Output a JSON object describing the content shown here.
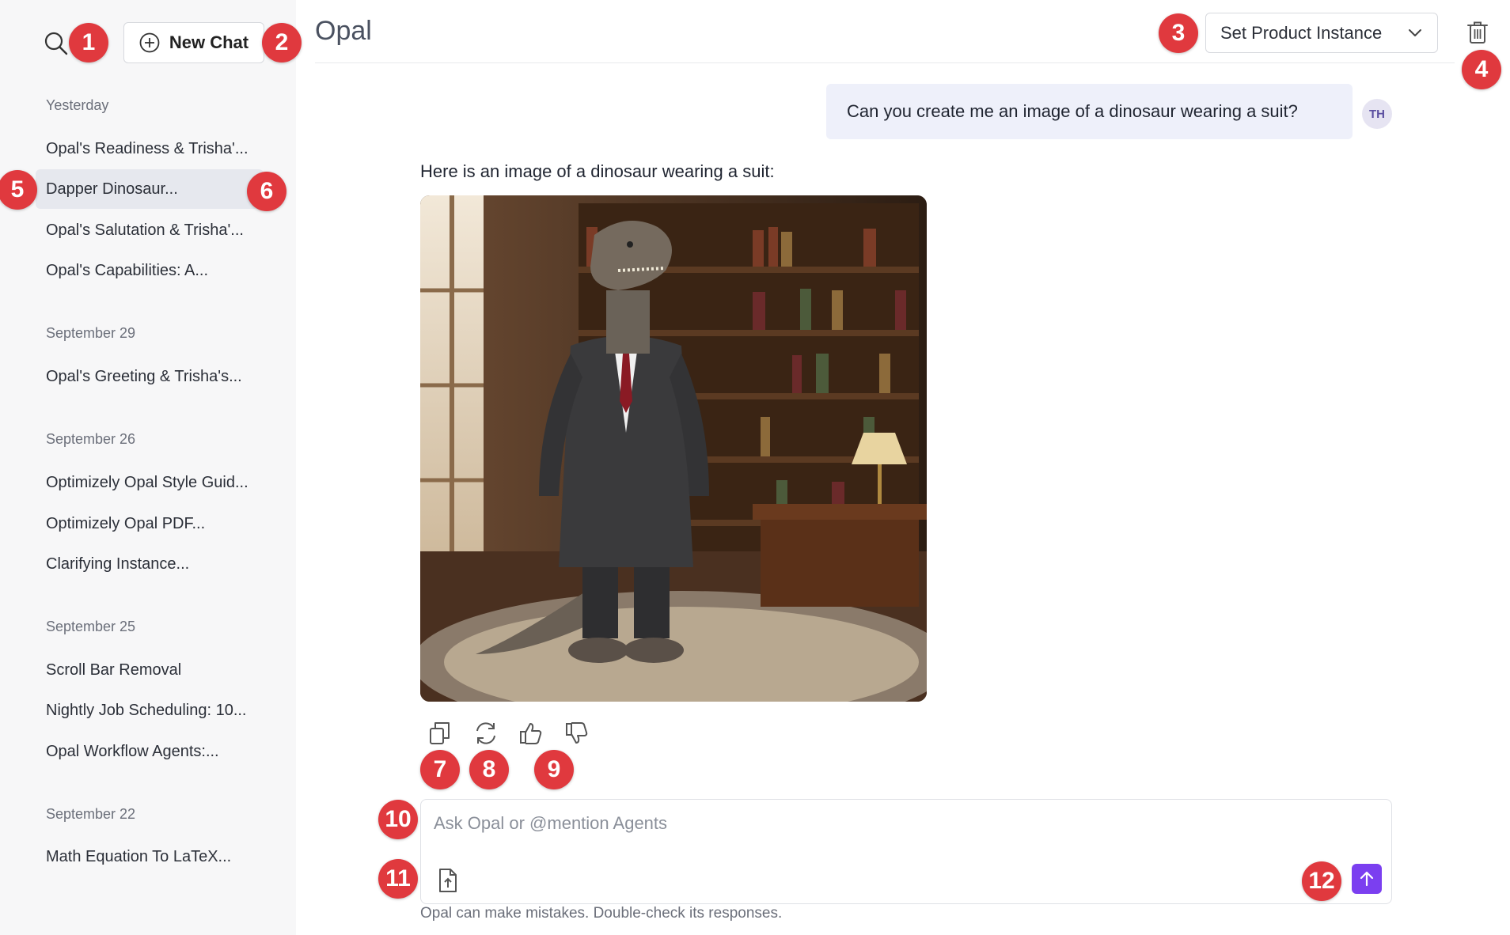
{
  "app": {
    "title": "Opal"
  },
  "sidebar": {
    "new_chat_label": "New Chat",
    "groups": [
      {
        "label": "Yesterday",
        "items": [
          "Opal's Readiness & Trisha'...",
          "Dapper Dinosaur...",
          "Opal's Salutation & Trisha'...",
          "Opal's Capabilities: A..."
        ]
      },
      {
        "label": "September 29",
        "items": [
          "Opal's Greeting & Trisha's..."
        ]
      },
      {
        "label": "September 26",
        "items": [
          "Optimizely Opal Style Guid...",
          "Optimizely Opal PDF...",
          "Clarifying Instance..."
        ]
      },
      {
        "label": "September 25",
        "items": [
          "Scroll Bar Removal",
          "Nightly Job Scheduling: 10...",
          "Opal Workflow Agents:..."
        ]
      },
      {
        "label": "September 22",
        "items": [
          "Math Equation To LaTeX..."
        ]
      }
    ]
  },
  "header": {
    "instance_label": "Set Product Instance"
  },
  "chat": {
    "user_message": "Can you create me an image of a dinosaur wearing a suit?",
    "user_initials": "TH",
    "assistant_text": "Here is an image of a dinosaur wearing a suit:"
  },
  "composer": {
    "placeholder": "Ask Opal or @mention Agents",
    "disclaimer": "Opal can make mistakes. Double-check its responses."
  },
  "markers": [
    "1",
    "2",
    "3",
    "4",
    "5",
    "6",
    "7",
    "8",
    "9",
    "10",
    "11",
    "12"
  ],
  "icons": [
    "search-icon",
    "plus-circle-icon",
    "chevron-down-icon",
    "trash-icon",
    "more-vertical-icon",
    "copy-icon",
    "regenerate-icon",
    "thumbs-up-icon",
    "thumbs-down-icon",
    "upload-file-icon",
    "arrow-up-icon"
  ],
  "colors": {
    "accent": "#7b3ff0",
    "marker": "#e0393e",
    "sidebar_bg": "#f7f7f8",
    "active_item": "#e6e8ee",
    "user_bubble": "#eef0fa"
  }
}
